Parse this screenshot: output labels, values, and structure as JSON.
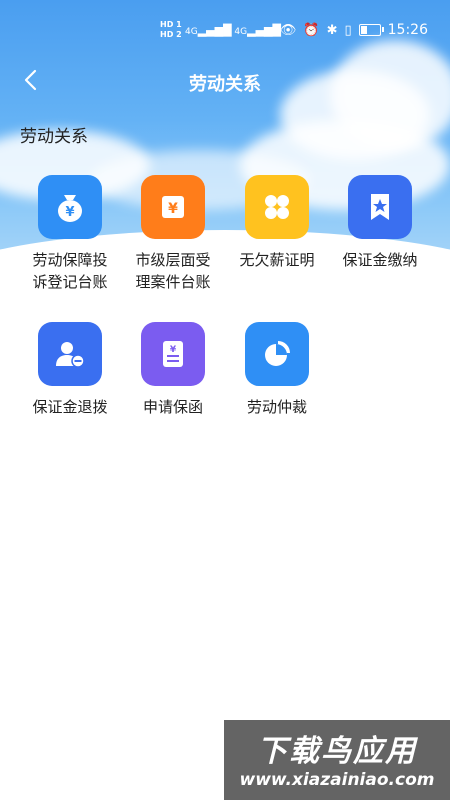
{
  "status_bar": {
    "hd1": "HD 1",
    "hd2": "HD 2",
    "net1": "4G",
    "net2": "4G",
    "time": "15:26",
    "icons": [
      "eye-icon",
      "alarm-icon",
      "bluetooth-icon",
      "vibrate-icon",
      "battery-icon"
    ]
  },
  "nav": {
    "title": "劳动关系"
  },
  "section": {
    "title": "劳动关系"
  },
  "items": [
    {
      "label_line1": "劳动保障投",
      "label_line2": "诉登记台账",
      "color": "#2f8ff5",
      "icon": "money-bag-icon"
    },
    {
      "label_line1": "市级层面受",
      "label_line2": "理案件台账",
      "color": "#ff7d1a",
      "icon": "yen-document-icon"
    },
    {
      "label_line1": "无欠薪证明",
      "label_line2": "",
      "color": "#ffc21f",
      "icon": "clover-icon"
    },
    {
      "label_line1": "保证金缴纳",
      "label_line2": "",
      "color": "#3a6ff0",
      "icon": "bookmark-star-icon"
    },
    {
      "label_line1": "保证金退拨",
      "label_line2": "",
      "color": "#3a6ff0",
      "icon": "user-minus-icon"
    },
    {
      "label_line1": "申请保函",
      "label_line2": "",
      "color": "#7b5cf0",
      "icon": "yen-receipt-icon"
    },
    {
      "label_line1": "劳动仲裁",
      "label_line2": "",
      "color": "#2f8ff5",
      "icon": "pie-chart-icon"
    }
  ],
  "watermark": {
    "main": "下载鸟应用",
    "sub": "www.xiazainiao.com"
  }
}
